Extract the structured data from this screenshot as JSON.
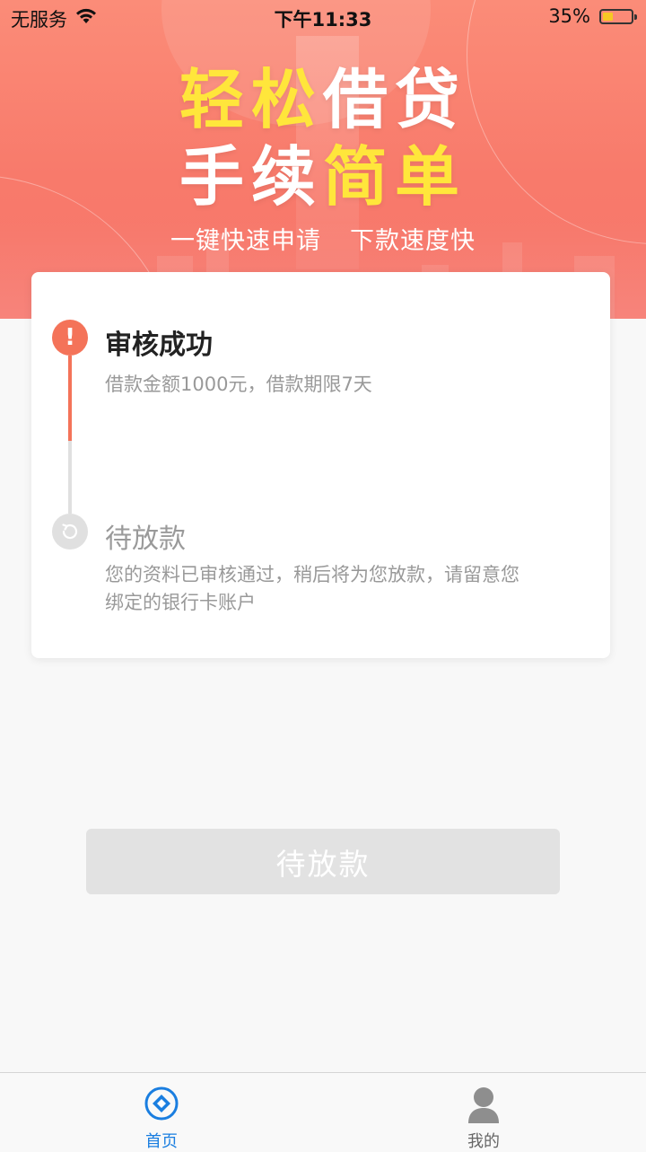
{
  "status_bar": {
    "carrier": "无服务",
    "time": "下午11:33",
    "battery": "35%",
    "battery_level": 0.35
  },
  "banner": {
    "title_line1": [
      "轻",
      "松",
      "借",
      "贷"
    ],
    "title_line2": [
      "手",
      "续",
      "简",
      "单"
    ],
    "slogan_left": "一键快速申请",
    "slogan_right": "下款速度快",
    "accent_color": "#ffe63b"
  },
  "progress": {
    "steps": [
      {
        "title": "审核成功",
        "description": "借款金额1000元，借款期限7天",
        "icon": "alert-icon",
        "color": "#f47359"
      },
      {
        "title": "待放款",
        "description": "您的资料已审核通过，稍后将为您放款，请留意您绑定的银行卡账户",
        "icon": "pending-icon",
        "color": "#e0e0e0"
      }
    ]
  },
  "action": {
    "button_label": "待放款"
  },
  "tabbar": {
    "items": [
      {
        "label": "首页",
        "icon": "home-icon",
        "active": true,
        "color": "#1a7ee0"
      },
      {
        "label": "我的",
        "icon": "user-icon",
        "active": false,
        "color": "#666666"
      }
    ]
  }
}
